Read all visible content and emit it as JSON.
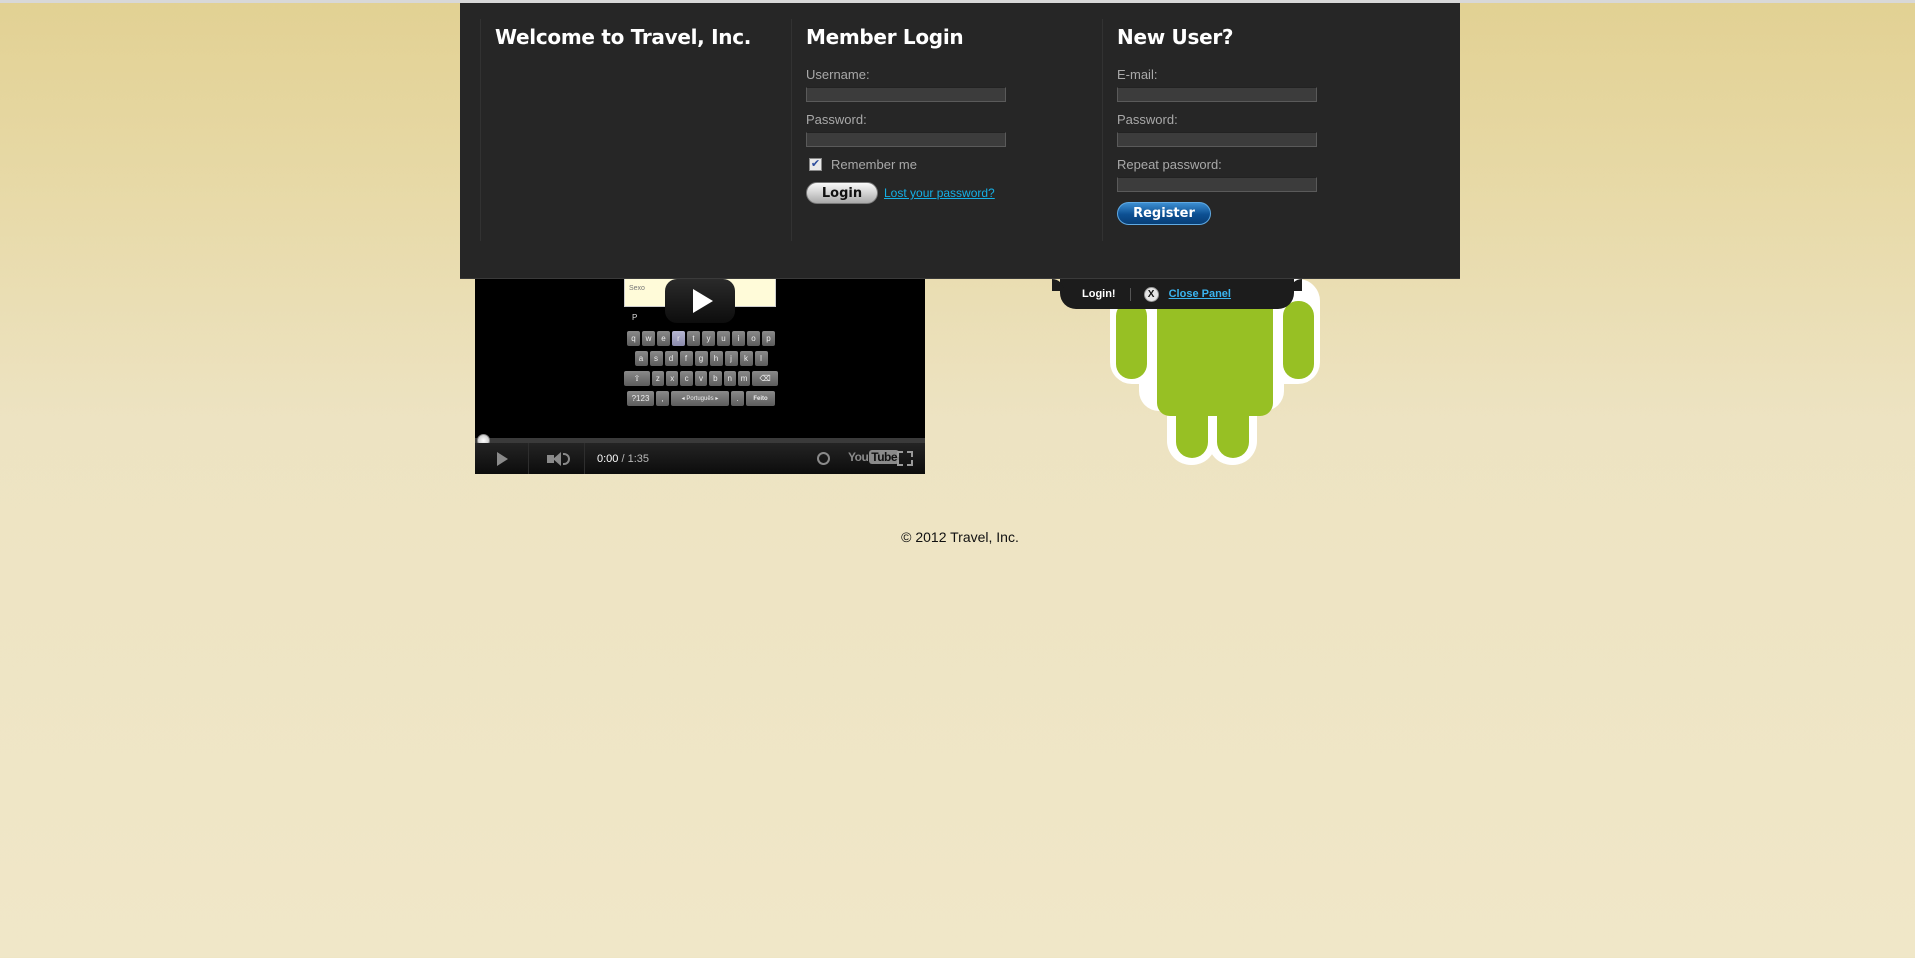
{
  "panel": {
    "welcome": {
      "title": "Welcome to Travel, Inc."
    },
    "login": {
      "title": "Member Login",
      "username_label": "Username:",
      "username_value": "",
      "password_label": "Password:",
      "password_value": "",
      "remember_label": "Remember me",
      "remember_checked": true,
      "login_button": "Login",
      "lost_password_link": "Lost your password?"
    },
    "register": {
      "title": "New User?",
      "email_label": "E-mail:",
      "email_value": "",
      "password_label": "Password:",
      "password_value": "",
      "repeat_password_label": "Repeat password:",
      "repeat_password_value": "",
      "register_button": "Register"
    }
  },
  "tab": {
    "login_label": "Login!",
    "close_icon_glyph": "X",
    "close_label": "Close Panel"
  },
  "video": {
    "overlay_hint": "Sexo",
    "overlay_letter": "P",
    "keyboard": {
      "row1": [
        "q",
        "w",
        "e",
        "r",
        "t",
        "y",
        "u",
        "i",
        "o",
        "p"
      ],
      "row2": [
        "a",
        "s",
        "d",
        "f",
        "g",
        "h",
        "j",
        "k",
        "l"
      ],
      "row3": [
        "⇧",
        "z",
        "x",
        "c",
        "v",
        "b",
        "n",
        "m",
        "⌫"
      ],
      "row4": [
        "?123",
        ",",
        "◂ Português ▸",
        ".",
        "Feito"
      ]
    },
    "time_current": "0:00",
    "time_separator": " / ",
    "time_total": "1:35",
    "progress": 0,
    "logo_you": "You",
    "logo_tube": "Tube"
  },
  "footer": {
    "copyright": "© 2012 Travel, Inc."
  },
  "colors": {
    "panel_bg": "#262626",
    "link": "#15b0e6",
    "register_button": "#0c4f92",
    "android_green": "#97c024",
    "page_bg": "#ede3c2"
  }
}
